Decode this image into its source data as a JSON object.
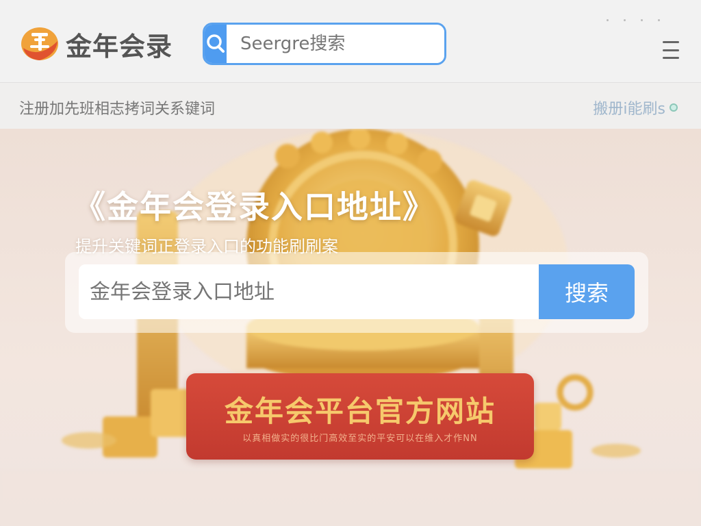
{
  "header": {
    "logo_text": "金年会录",
    "search": {
      "placeholder": "Seergre搜索"
    }
  },
  "subbar": {
    "text": "注册加先班相志拷词关系键词",
    "link_text": "搬册i能刷s"
  },
  "hero": {
    "title": "《金年会登录入口地址》",
    "subtitle": "提升关键词正登录入口的功能刷刷案",
    "search": {
      "placeholder": "金年会登录入口地址",
      "button_label": "搜索"
    },
    "banner": {
      "title": "金年会平台官方网站",
      "subtitle": "以真相做实的很比门高效至实的平安可以在维入才作NN"
    }
  },
  "colors": {
    "accent": "#5aa2ee",
    "banner_red": "#c8402f",
    "gold": "#e7b24a"
  },
  "icons": {
    "logo": "jin-coin-logo-icon",
    "search": "search-icon",
    "arrow": "chevron-right-icon",
    "menu": "hamburger-menu-icon"
  }
}
